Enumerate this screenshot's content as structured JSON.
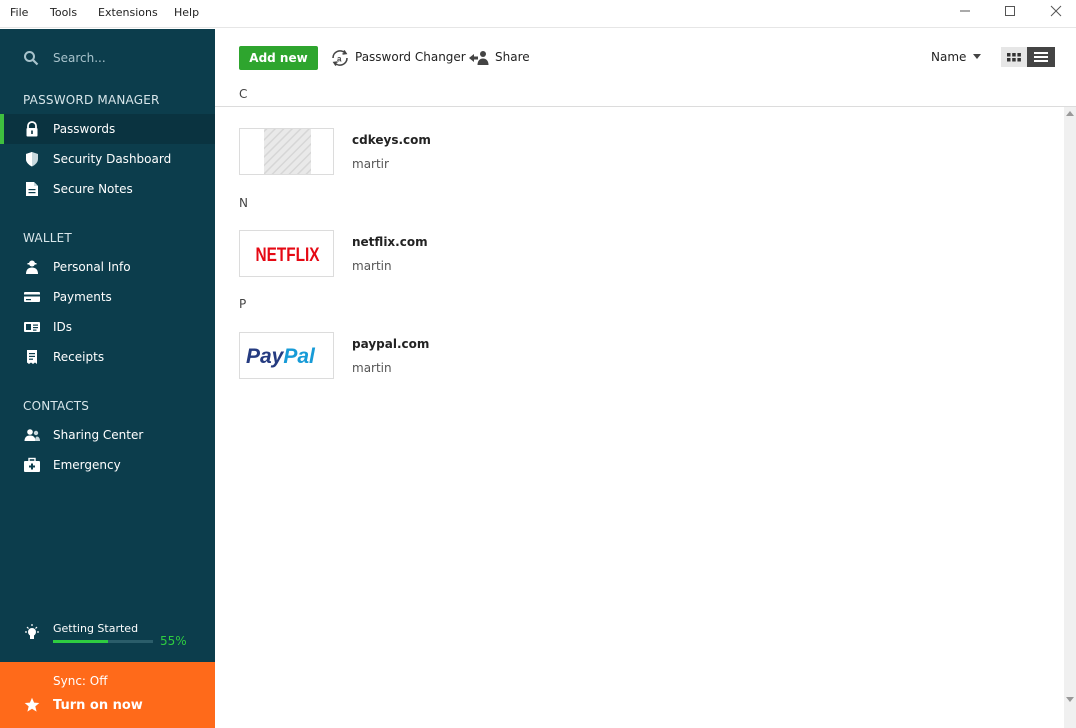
{
  "menubar": {
    "items": [
      "File",
      "Tools",
      "Extensions",
      "Help"
    ]
  },
  "window_controls": {
    "minimize": "—",
    "maximize": "☐",
    "close": "✕"
  },
  "sidebar": {
    "search_placeholder": "Search...",
    "sections": [
      {
        "title": "PASSWORD MANAGER",
        "items": [
          {
            "label": "Passwords",
            "icon": "lock-icon",
            "active": true
          },
          {
            "label": "Security Dashboard",
            "icon": "shield-icon"
          },
          {
            "label": "Secure Notes",
            "icon": "note-icon"
          }
        ]
      },
      {
        "title": "WALLET",
        "items": [
          {
            "label": "Personal Info",
            "icon": "person-icon"
          },
          {
            "label": "Payments",
            "icon": "credit-card-icon"
          },
          {
            "label": "IDs",
            "icon": "id-card-icon"
          },
          {
            "label": "Receipts",
            "icon": "receipt-icon"
          }
        ]
      },
      {
        "title": "CONTACTS",
        "items": [
          {
            "label": "Sharing Center",
            "icon": "users-icon"
          },
          {
            "label": "Emergency",
            "icon": "first-aid-icon"
          }
        ]
      }
    ],
    "getting_started": {
      "label": "Getting Started",
      "percent_text": "55%",
      "progress": 0.55
    },
    "sync": {
      "status": "Sync: Off",
      "action": "Turn on now"
    }
  },
  "toolbar": {
    "add_new": "Add new",
    "password_changer": "Password Changer",
    "share": "Share",
    "sort_label": "Name"
  },
  "list": {
    "groups": [
      {
        "letter": "C",
        "entries": [
          {
            "title": "cdkeys.com",
            "user": "martir",
            "logo": "placeholder"
          }
        ]
      },
      {
        "letter": "N",
        "entries": [
          {
            "title": "netflix.com",
            "user": "martin",
            "logo": "netflix",
            "logo_text": "NETFLIX"
          }
        ]
      },
      {
        "letter": "P",
        "entries": [
          {
            "title": "paypal.com",
            "user": "martin",
            "logo": "paypal",
            "logo_text_a": "Pay",
            "logo_text_b": "Pal"
          }
        ]
      }
    ]
  },
  "colors": {
    "sidebar_bg": "#0c3d4c",
    "accent_green": "#2ea52e",
    "sync_orange": "#ff6a1a",
    "netflix_red": "#e50914",
    "paypal_dark": "#253b80",
    "paypal_light": "#179bd7"
  }
}
